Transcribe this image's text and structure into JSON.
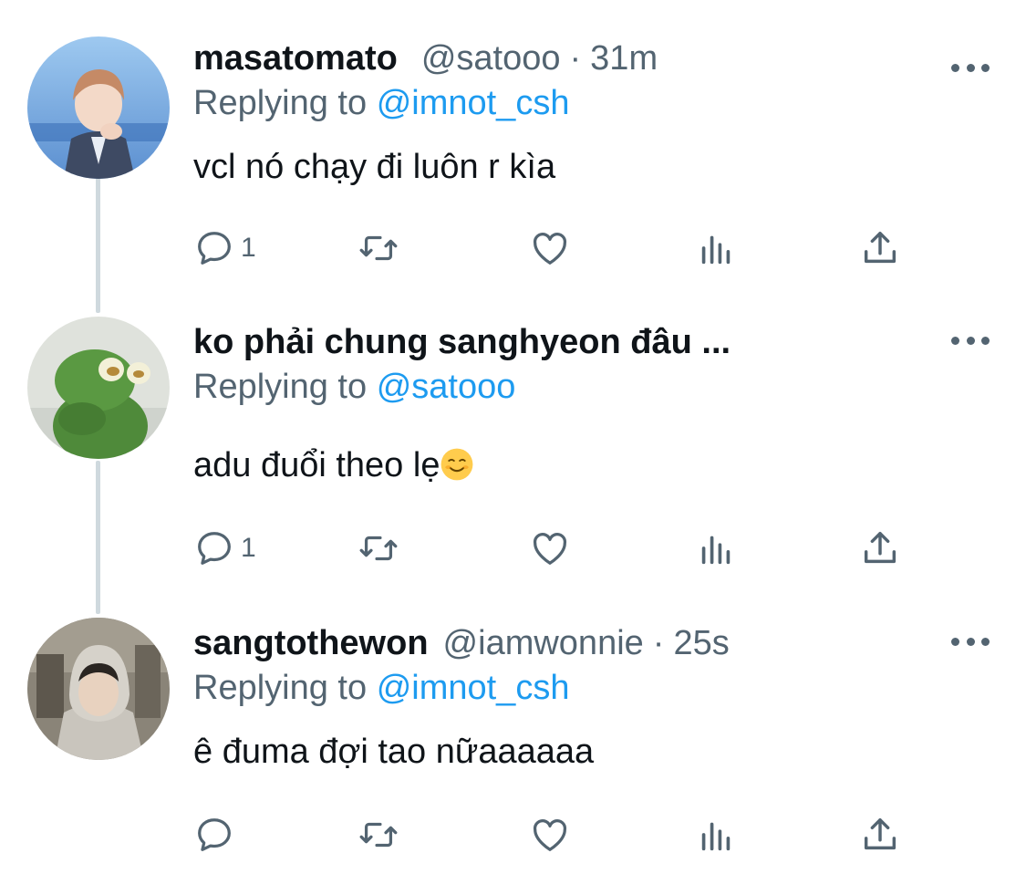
{
  "icons": {
    "more": "more-horizontal-icon",
    "reply": "reply-bubble-icon",
    "retweet": "retweet-icon",
    "like": "heart-icon",
    "analytics": "analytics-bars-icon",
    "share": "share-upload-icon"
  },
  "colors": {
    "text": "#0f1419",
    "secondary": "#536471",
    "link": "#1d9bf0",
    "thread_line": "#cfd9de"
  },
  "tweets": [
    {
      "name": "masatomato",
      "handle": "@satooo",
      "separator": "·",
      "time": "31m",
      "replying_prefix": "Replying to",
      "replying_to": "@imnot_csh",
      "text": "vcl nó chạy đi luôn r kìa",
      "reply_count": "1"
    },
    {
      "name": "ko phải chung sanghyeon đâu ...",
      "replying_prefix": "Replying to",
      "replying_to": "@satooo",
      "text": "adu đuổi theo lẹ",
      "emoji": "smiling-face-emoji",
      "reply_count": "1"
    },
    {
      "name": "sangtothewon",
      "handle": "@iamwonnie",
      "separator": "·",
      "time": "25s",
      "replying_prefix": "Replying to",
      "replying_to": "@imnot_csh",
      "text": "ê đuma đợi tao nữaaaaaa",
      "reply_count": ""
    }
  ]
}
